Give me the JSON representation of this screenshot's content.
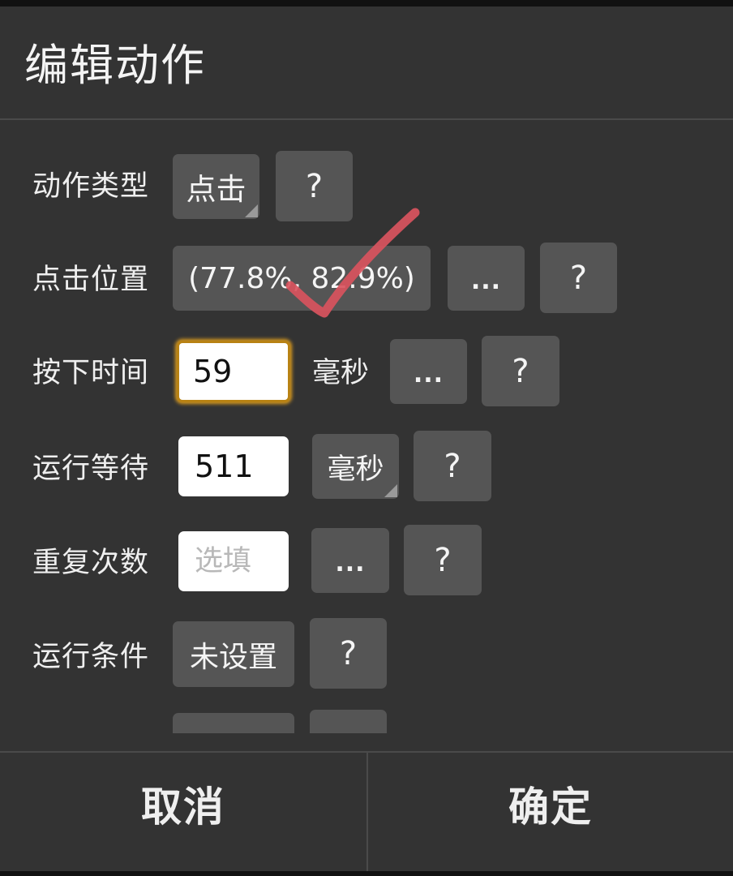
{
  "dialog": {
    "title": "编辑动作",
    "rows": {
      "action_type": {
        "label": "动作类型",
        "value": "点击",
        "help": "?"
      },
      "click_position": {
        "label": "点击位置",
        "value": "(77.8%, 82.9%)",
        "more": "...",
        "help": "?"
      },
      "press_time": {
        "label": "按下时间",
        "value": "59",
        "unit": "毫秒",
        "more": "...",
        "help": "?"
      },
      "run_wait": {
        "label": "运行等待",
        "value": "511",
        "unit": "毫秒",
        "help": "?"
      },
      "repeat_count": {
        "label": "重复次数",
        "placeholder": "选填",
        "more": "...",
        "help": "?"
      },
      "run_condition": {
        "label": "运行条件",
        "value": "未设置",
        "help": "?"
      }
    },
    "footer": {
      "cancel": "取消",
      "confirm": "确定"
    }
  },
  "annotation": {
    "color": "#d9545e",
    "icon": "checkmark-icon"
  }
}
